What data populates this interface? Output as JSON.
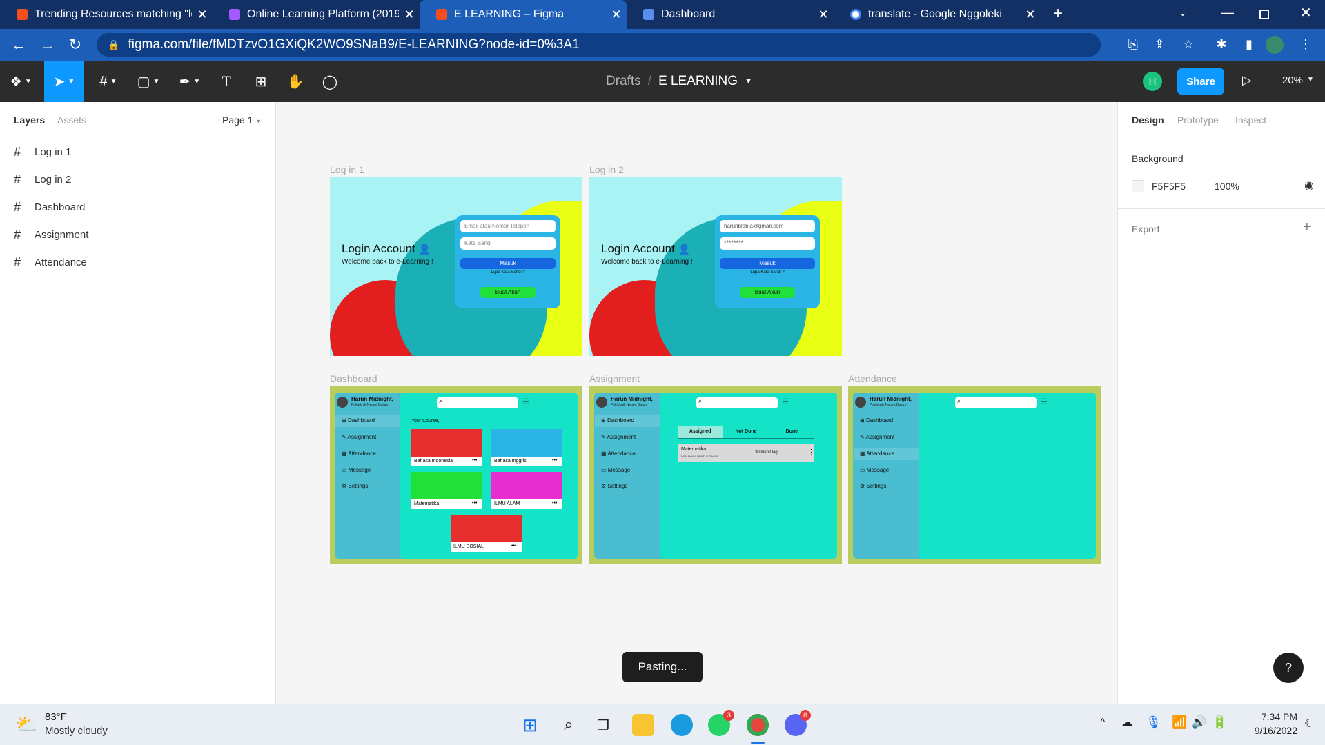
{
  "browser": {
    "tabs": [
      {
        "title": "Trending Resources matching \"le",
        "close": "✕",
        "color": "#f24e1e"
      },
      {
        "title": "Online Learning Platform (2019)",
        "close": "✕",
        "color": "#a259ff"
      },
      {
        "title": "E LEARNING – Figma",
        "close": "✕",
        "color": "#f24e1e"
      },
      {
        "title": "Dashboard",
        "close": "✕",
        "color": "#5b8def"
      },
      {
        "title": "translate - Google Nggoleki",
        "close": "✕",
        "color": "#4285f4"
      }
    ],
    "new_tab": "+",
    "url": "figma.com/file/fMDTzvO1GXiQK2WO9SNaB9/E-LEARNING?node-id=0%3A1"
  },
  "figma": {
    "breadcrumb_parent": "Drafts",
    "breadcrumb_sep": "/",
    "file_name": "E LEARNING",
    "avatar_letter": "H",
    "share_label": "Share",
    "zoom": "20%",
    "left_tabs": {
      "layers": "Layers",
      "assets": "Assets",
      "page": "Page 1"
    },
    "layers": [
      "Log in 1",
      "Log in 2",
      "Dashboard",
      "Assignment",
      "Attendance"
    ],
    "right_tabs": {
      "design": "Design",
      "prototype": "Prototype",
      "inspect": "Inspect"
    },
    "background_label": "Background",
    "background_hex": "F5F5F5",
    "background_opacity": "100%",
    "export_label": "Export",
    "toast": "Pasting...",
    "help": "?"
  },
  "frames": {
    "login1": {
      "label": "Log in 1",
      "title": "Login Account",
      "subtitle": "Welcome back to e-Learning !",
      "field1": "Email atau Nomor Telepon",
      "field2": "Kata Sandi",
      "submit": "Masuk",
      "forgot": "Lupa Kata Sandi ?",
      "create": "Buat Akun"
    },
    "login2": {
      "label": "Log in 2",
      "title": "Login Account",
      "subtitle": "Welcome back to e-Learning !",
      "field1": "harunblabla@gmail.com",
      "field2": "********",
      "submit": "Masuk",
      "forgot": "Lupa Kata Sandi ?",
      "create": "Buat Akun"
    },
    "dashboard": {
      "label": "Dashboard",
      "user_name": "Harun Midnight,",
      "user_sub": "Politeknik Negeri Batam",
      "menu": [
        "Dashboard",
        "Assignment",
        "Attendance",
        "Message",
        "Settings"
      ],
      "your_course": "Your Course,",
      "courses": [
        {
          "name": "Bahasa Indonesia",
          "color": "#e62e2e"
        },
        {
          "name": "Bahasa Inggris",
          "color": "#2bb5e6"
        },
        {
          "name": "Matematika",
          "color": "#22e03a"
        },
        {
          "name": "ILMU ALAM",
          "color": "#e62ecf"
        },
        {
          "name": "ILMU SOSIAL",
          "color": "#e62e2e"
        }
      ],
      "more": "•••"
    },
    "assignment": {
      "label": "Assignment",
      "tabs": [
        "Assigned",
        "Not Done",
        "Done"
      ],
      "task_title": "Matematika",
      "task_sub": "MEMAHAMI BENTUK DASAR",
      "task_time": "30 menit lagi",
      "task_more": "⋮"
    },
    "attendance": {
      "label": "Attendance"
    }
  },
  "taskbar": {
    "temp": "83°F",
    "weather": "Mostly cloudy",
    "time": "7:34 PM",
    "date": "9/16/2022",
    "whatsapp_badge": "3",
    "discord_badge": "8"
  }
}
